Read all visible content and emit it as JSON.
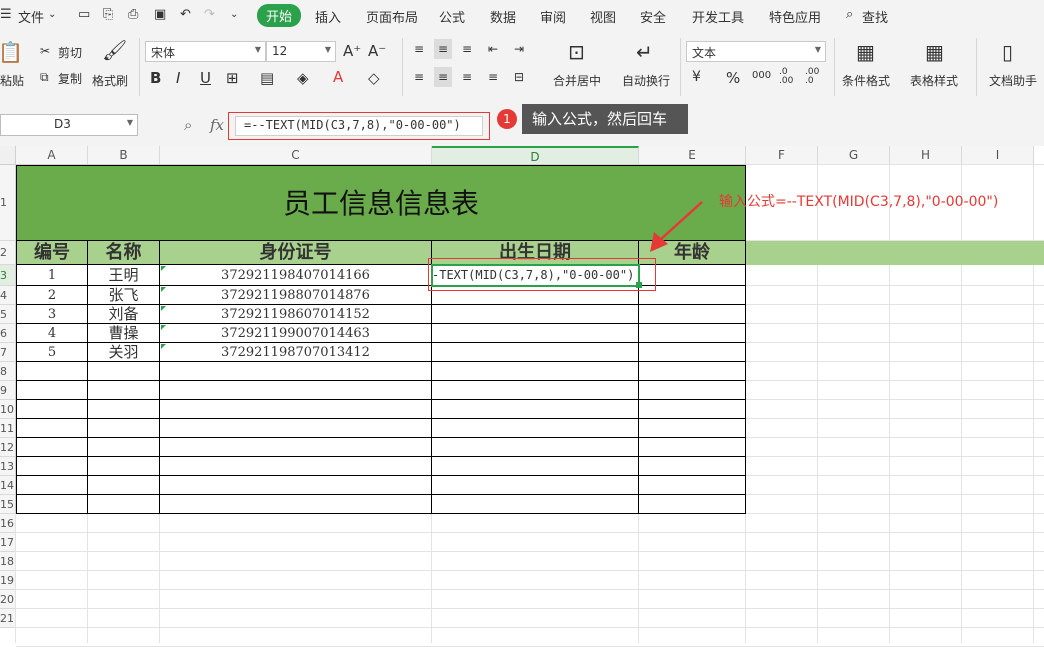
{
  "menu": {
    "file": "文件",
    "start": "开始",
    "insert": "插入",
    "layout": "页面布局",
    "formula": "公式",
    "data": "数据",
    "review": "审阅",
    "view": "视图",
    "security": "安全",
    "dev": "开发工具",
    "special": "特色应用",
    "search": "查找"
  },
  "ribbon": {
    "paste": "粘贴",
    "cut": "剪切",
    "copy": "复制",
    "format_painter": "格式刷",
    "font": "宋体",
    "size": "12",
    "merge": "合并居中",
    "wrap": "自动换行",
    "num_format": "文本",
    "cond_format": "条件格式",
    "table_style": "表格样式",
    "doc_helper": "文档助手",
    "percent": "%",
    "thousands": "000",
    "inc_dec": ".0\n.00",
    "dec_dec": ".00\n.0"
  },
  "formula_bar": {
    "cell_ref": "D3",
    "fx": "fx",
    "formula": "=--TEXT(MID(C3,7,8),\"0-00-00\")"
  },
  "callout": {
    "step": "1",
    "text": "输入公式，然后回车"
  },
  "annotation": "输入公式=--TEXT(MID(C3,7,8),\"0-00-00\")",
  "accent_colors": {
    "green": "#6aac4c",
    "light_green": "#a9d18e",
    "ribbon_active": "#2aa14a",
    "red": "#e53935"
  },
  "columns": [
    "A",
    "B",
    "C",
    "D",
    "E",
    "F",
    "G",
    "H",
    "I"
  ],
  "row_numbers": [
    "1",
    "2",
    "3",
    "4",
    "5",
    "6",
    "7",
    "8",
    "9",
    "10",
    "11",
    "12",
    "13",
    "14",
    "15",
    "16",
    "17",
    "18",
    "19",
    "20",
    "21"
  ],
  "sheet": {
    "title": "员工信息信息表",
    "headers": [
      "编号",
      "名称",
      "身份证号",
      "出生日期",
      "年龄"
    ],
    "rows": [
      {
        "id": "1",
        "name": "王明",
        "idno": "372921198407014166",
        "birth": "-TEXT(MID(C3,7,8),\"0-00-00\")",
        "age": ""
      },
      {
        "id": "2",
        "name": "张飞",
        "idno": "372921198807014876",
        "birth": "",
        "age": ""
      },
      {
        "id": "3",
        "name": "刘备",
        "idno": "372921198607014152",
        "birth": "",
        "age": ""
      },
      {
        "id": "4",
        "name": "曹操",
        "idno": "372921199007014463",
        "birth": "",
        "age": ""
      },
      {
        "id": "5",
        "name": "关羽",
        "idno": "372921198707013412",
        "birth": "",
        "age": ""
      }
    ]
  }
}
